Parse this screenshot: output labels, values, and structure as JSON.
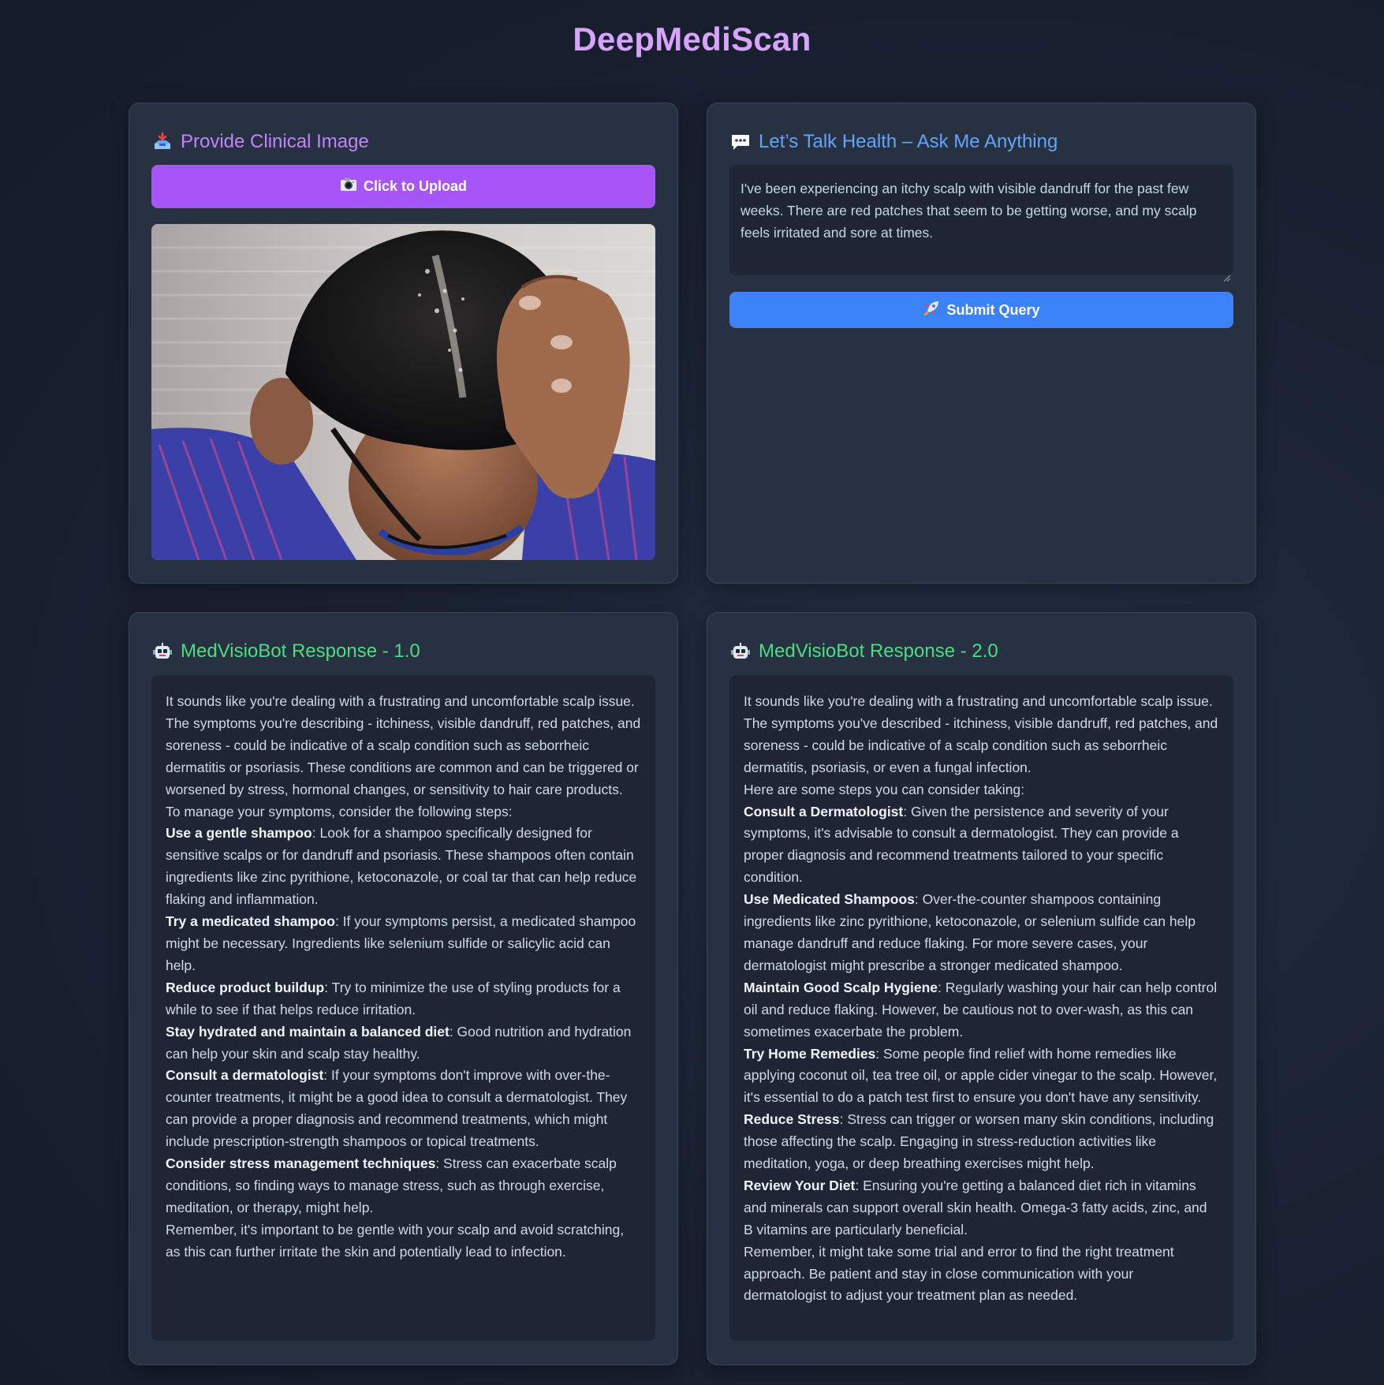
{
  "app": {
    "title": "DeepMediScan"
  },
  "upload": {
    "heading": "Provide Clinical Image",
    "button_label": "Click to Upload"
  },
  "query": {
    "heading": "Let’s Talk Health – Ask Me Anything",
    "text": "I've been experiencing an itchy scalp with visible dandruff for the past few weeks. There are red patches that seem to be getting worse, and my scalp feels irritated and sore at times.",
    "submit_label": "Submit Query"
  },
  "response1": {
    "heading": "MedVisioBot Response - 1.0",
    "intro": "It sounds like you're dealing with a frustrating and uncomfortable scalp issue. The symptoms you're describing - itchiness, visible dandruff, red patches, and soreness - could be indicative of a scalp condition such as seborrheic dermatitis or psoriasis. These conditions are common and can be triggered or worsened by stress, hormonal changes, or sensitivity to hair care products.",
    "lead": "To manage your symptoms, consider the following steps:",
    "steps": [
      {
        "title": "Use a gentle shampoo",
        "text": ": Look for a shampoo specifically designed for sensitive scalps or for dandruff and psoriasis. These shampoos often contain ingredients like zinc pyrithione, ketoconazole, or coal tar that can help reduce flaking and inflammation."
      },
      {
        "title": "Try a medicated shampoo",
        "text": ": If your symptoms persist, a medicated shampoo might be necessary. Ingredients like selenium sulfide or salicylic acid can help."
      },
      {
        "title": "Reduce product buildup",
        "text": ": Try to minimize the use of styling products for a while to see if that helps reduce irritation."
      },
      {
        "title": "Stay hydrated and maintain a balanced diet",
        "text": ": Good nutrition and hydration can help your skin and scalp stay healthy."
      },
      {
        "title": "Consult a dermatologist",
        "text": ": If your symptoms don't improve with over-the-counter treatments, it might be a good idea to consult a dermatologist. They can provide a proper diagnosis and recommend treatments, which might include prescription-strength shampoos or topical treatments."
      },
      {
        "title": "Consider stress management techniques",
        "text": ": Stress can exacerbate scalp conditions, so finding ways to manage stress, such as through exercise, meditation, or therapy, might help."
      }
    ],
    "outro": "Remember, it's important to be gentle with your scalp and avoid scratching, as this can further irritate the skin and potentially lead to infection."
  },
  "response2": {
    "heading": "MedVisioBot Response - 2.0",
    "intro": "It sounds like you're dealing with a frustrating and uncomfortable scalp issue. The symptoms you've described - itchiness, visible dandruff, red patches, and soreness - could be indicative of a scalp condition such as seborrheic dermatitis, psoriasis, or even a fungal infection.",
    "lead": "Here are some steps you can consider taking:",
    "steps": [
      {
        "title": "Consult a Dermatologist",
        "text": ": Given the persistence and severity of your symptoms, it's advisable to consult a dermatologist. They can provide a proper diagnosis and recommend treatments tailored to your specific condition."
      },
      {
        "title": "Use Medicated Shampoos",
        "text": ": Over-the-counter shampoos containing ingredients like zinc pyrithione, ketoconazole, or selenium sulfide can help manage dandruff and reduce flaking. For more severe cases, your dermatologist might prescribe a stronger medicated shampoo."
      },
      {
        "title": "Maintain Good Scalp Hygiene",
        "text": ": Regularly washing your hair can help control oil and reduce flaking. However, be cautious not to over-wash, as this can sometimes exacerbate the problem."
      },
      {
        "title": "Try Home Remedies",
        "text": ": Some people find relief with home remedies like applying coconut oil, tea tree oil, or apple cider vinegar to the scalp. However, it's essential to do a patch test first to ensure you don't have any sensitivity."
      },
      {
        "title": "Reduce Stress",
        "text": ": Stress can trigger or worsen many skin conditions, including those affecting the scalp. Engaging in stress-reduction activities like meditation, yoga, or deep breathing exercises might help."
      },
      {
        "title": "Review Your Diet",
        "text": ": Ensuring you're getting a balanced diet rich in vitamins and minerals can support overall skin health. Omega-3 fatty acids, zinc, and B vitamins are particularly beneficial."
      }
    ],
    "outro": "Remember, it might take some trial and error to find the right treatment approach. Be patient and stay in close communication with your dermatologist to adjust your treatment plan as needed."
  },
  "colors": {
    "accent_purple": "#a855f7",
    "accent_blue": "#3b82f6",
    "accent_green": "#4ade80"
  }
}
